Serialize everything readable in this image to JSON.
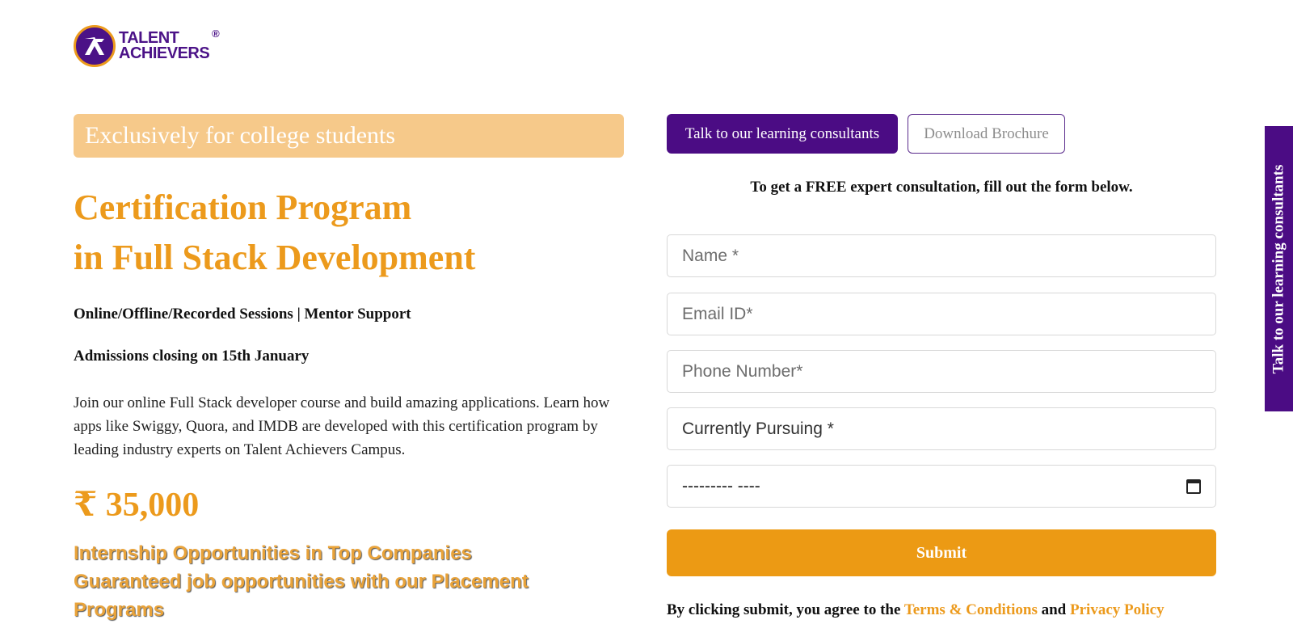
{
  "brand": {
    "line1": "TALENT",
    "line2": "ACHIEVERS",
    "registered": "®",
    "colors": {
      "purple": "#4b0c84",
      "orange": "#ec9a1c"
    }
  },
  "hero": {
    "tagline": "Exclusively for college students",
    "title_line1": "Certification Program",
    "title_line2": "in Full Stack Development",
    "sessions": "Online/Offline/Recorded Sessions | Mentor Support",
    "admissions": "Admissions closing on 15th January",
    "description": "Join our online Full Stack developer course and build amazing applications. Learn how apps like Swiggy, Quora, and IMDB are developed with this certification program by leading industry experts on Talent Achievers Campus.",
    "price": "₹ 35,000",
    "highlights": [
      "Internship Opportunities in Top Companies",
      "Guaranteed job opportunities with our Placement Programs"
    ]
  },
  "actions": {
    "consult_label": "Talk to our learning consultants",
    "brochure_label": "Download Brochure"
  },
  "form": {
    "heading": "To get a FREE expert consultation, fill out the form below.",
    "name_placeholder": "Name *",
    "email_placeholder": "Email ID*",
    "phone_placeholder": "Phone Number*",
    "pursuing_value": "Currently Pursuing *",
    "date_value": "--------- ----",
    "submit_label": "Submit",
    "agree_prefix": "By clicking submit, you agree to the ",
    "terms_label": "Terms & Conditions",
    "agree_and": " and ",
    "privacy_label": "Privacy Policy"
  },
  "side_tab": {
    "label": "Talk to our learning consultants"
  }
}
